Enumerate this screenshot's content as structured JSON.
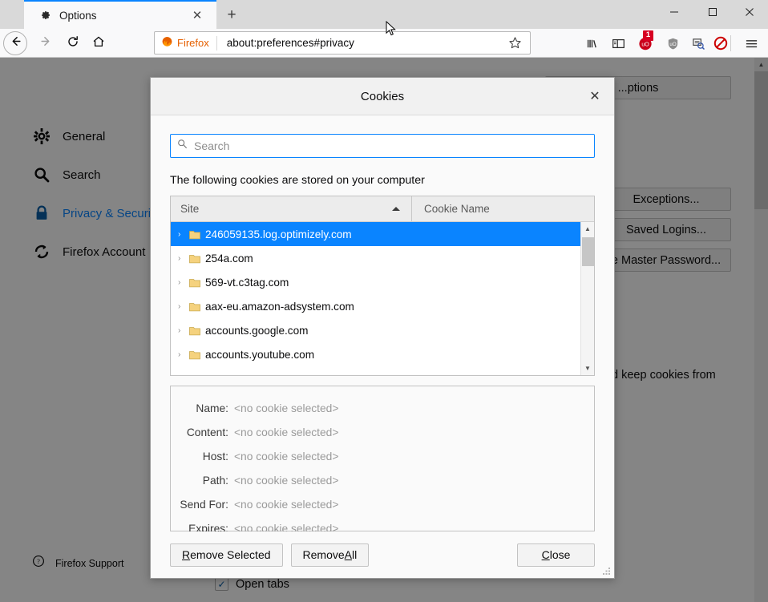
{
  "window": {
    "tab_title": "Options",
    "tab_icon": "gear-icon",
    "new_tab_label": "+",
    "minimize_label": "─",
    "maximize_label": "☐",
    "close_label": "✕"
  },
  "navbar": {
    "back_icon": "back-arrow-icon",
    "forward_icon": "forward-arrow-icon",
    "reload_icon": "reload-icon",
    "home_icon": "home-icon",
    "identity_label": "Firefox",
    "url": "about:preferences#privacy",
    "star_icon": "bookmark-star-icon",
    "toolbar_icons": [
      {
        "name": "library-icon",
        "badge": null
      },
      {
        "name": "sidebars-icon",
        "badge": null
      },
      {
        "name": "ublock-origin-icon",
        "badge": "1"
      },
      {
        "name": "shield-icon",
        "badge": null
      },
      {
        "name": "screenshot-icon",
        "badge": null
      },
      {
        "name": "blocker-icon",
        "badge": null
      }
    ],
    "menu_icon": "hamburger-menu-icon"
  },
  "sidebar": {
    "items": [
      {
        "label": "General",
        "icon": "gear-icon",
        "active": false
      },
      {
        "label": "Search",
        "icon": "magnifier-icon",
        "active": false
      },
      {
        "label": "Privacy & Security",
        "icon": "lock-icon",
        "active": true
      },
      {
        "label": "Firefox Account",
        "icon": "sync-icon",
        "active": false
      }
    ],
    "support_label": "Firefox Support",
    "support_icon": "question-circle-icon"
  },
  "page_background": {
    "top_button": "...ptions",
    "buttons": [
      {
        "label": "Exceptions...",
        "accesskey": "x"
      },
      {
        "label": "Saved Logins...",
        "accesskey": "L"
      },
      {
        "label": "e Master Password...",
        "accesskey": "M"
      }
    ],
    "keep_cookies_text": "d keep cookies from",
    "open_tabs_label": "Open tabs",
    "open_tabs_checked": true,
    "checkmark": "✓"
  },
  "dialog": {
    "title": "Cookies",
    "close_icon": "close-icon",
    "search": {
      "placeholder": "Search",
      "value": "",
      "icon": "search-icon"
    },
    "description": "The following cookies are stored on your computer",
    "columns": [
      {
        "key": "site",
        "label": "Site",
        "sorted": "asc"
      },
      {
        "key": "cookie_name",
        "label": "Cookie Name",
        "sorted": null
      }
    ],
    "rows": [
      {
        "site": "246059135.log.optimizely.com",
        "selected": true
      },
      {
        "site": "254a.com",
        "selected": false
      },
      {
        "site": "569-vt.c3tag.com",
        "selected": false
      },
      {
        "site": "aax-eu.amazon-adsystem.com",
        "selected": false
      },
      {
        "site": "accounts.google.com",
        "selected": false
      },
      {
        "site": "accounts.youtube.com",
        "selected": false
      }
    ],
    "twisty_glyph": "›",
    "details": [
      {
        "label": "Name:",
        "value": "<no cookie selected>"
      },
      {
        "label": "Content:",
        "value": "<no cookie selected>"
      },
      {
        "label": "Host:",
        "value": "<no cookie selected>"
      },
      {
        "label": "Path:",
        "value": "<no cookie selected>"
      },
      {
        "label": "Send For:",
        "value": "<no cookie selected>"
      },
      {
        "label": "Expires:",
        "value": "<no cookie selected>"
      }
    ],
    "buttons": {
      "remove_selected": {
        "pre": "",
        "accesskey": "R",
        "post": "emove Selected"
      },
      "remove_all": {
        "pre": "Remove ",
        "accesskey": "A",
        "post": "ll"
      },
      "close": {
        "pre": "",
        "accesskey": "C",
        "post": "lose"
      }
    }
  },
  "colors": {
    "accent": "#0a84ff",
    "tab_accent": "#0a84ff",
    "badge": "#d70022",
    "firefox_orange": "#e66000",
    "selection": "#0a84ff"
  }
}
